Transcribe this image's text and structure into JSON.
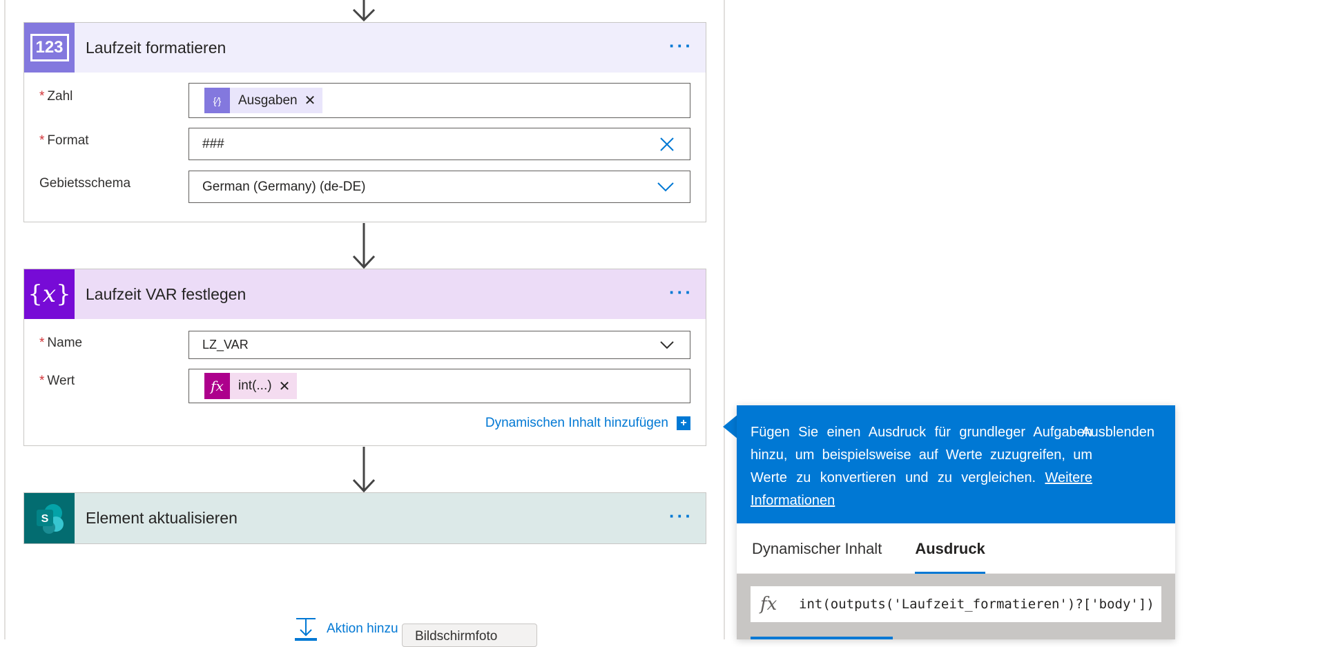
{
  "colors": {
    "accent": "#0078d4",
    "number_action": "#8378de",
    "variable_action": "#770bd6",
    "sharepoint_action": "#036c70",
    "expression_token": "#ad008c"
  },
  "actions": [
    {
      "title": "Laufzeit formatieren",
      "icon": "number-format-icon",
      "icon_text": "123",
      "more_label": "···",
      "fields": {
        "zahl": {
          "label": "Zahl",
          "token": "Ausgaben",
          "remove": "✕"
        },
        "format": {
          "label": "Format",
          "value": "###"
        },
        "locale": {
          "label": "Gebietsschema",
          "value": "German (Germany) (de-DE)"
        }
      }
    },
    {
      "title": "Laufzeit VAR festlegen",
      "icon": "variable-icon",
      "more_label": "···",
      "fields": {
        "name": {
          "label": "Name",
          "value": "LZ_VAR"
        },
        "wert": {
          "label": "Wert",
          "token": "int(...)",
          "remove": "✕"
        }
      },
      "dynamic_link": "Dynamischen Inhalt hinzufügen"
    },
    {
      "title": "Element aktualisieren",
      "icon": "sharepoint-icon",
      "more_label": "···"
    }
  ],
  "add_action": "Aktion hinzu",
  "tooltip": "Bildschirmfoto",
  "panel": {
    "info_text": "Fügen Sie einen Ausdruck für grundleger Aufgaben hinzu, um beispielsweise auf Werte zuzugreifen, um Werte zu konvertieren und zu vergleichen.",
    "info_link": "Weitere Informationen",
    "hide_label": "Ausblenden",
    "tabs": [
      {
        "label": "Dynamischer Inhalt",
        "active": false
      },
      {
        "label": "Ausdruck",
        "active": true
      }
    ],
    "expression": "int(outputs('Laufzeit_formatieren')?['body'])"
  }
}
